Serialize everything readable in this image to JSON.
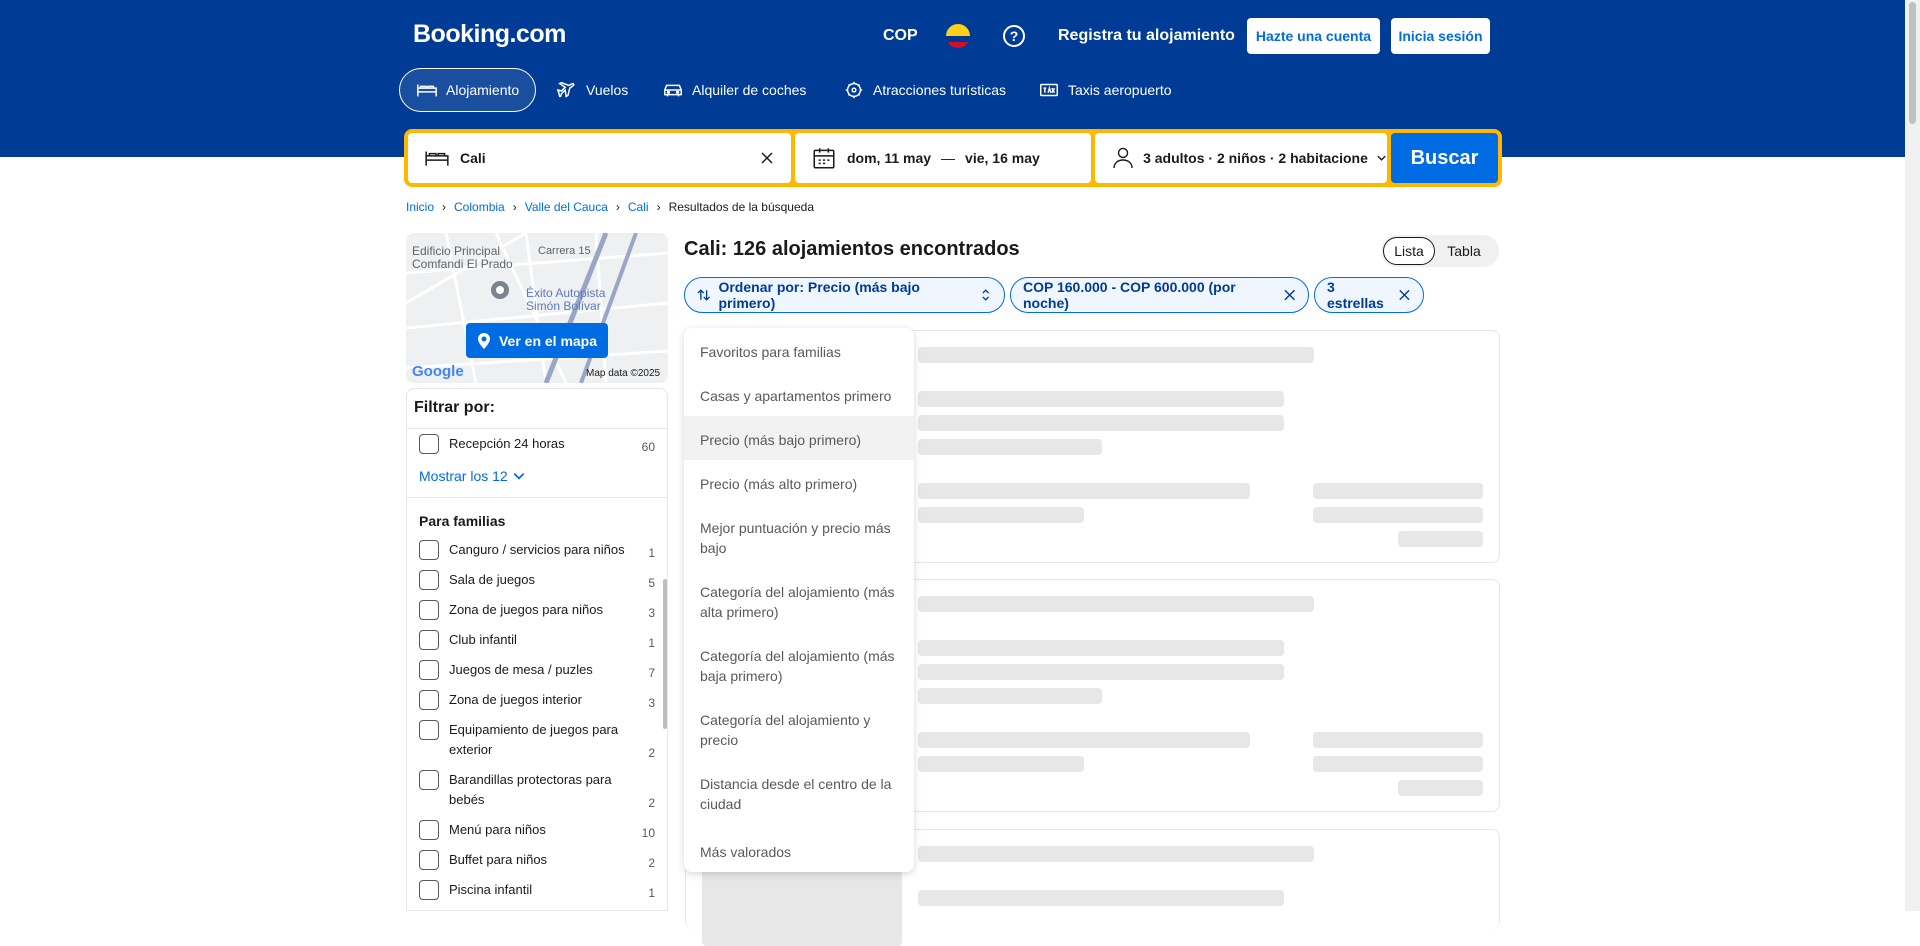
{
  "header": {
    "logo": "Booking.com",
    "currency": "COP",
    "register_property": "Registra tu alojamiento",
    "create_account": "Hazte una cuenta",
    "sign_in": "Inicia sesión",
    "nav": [
      "Alojamiento",
      "Vuelos",
      "Alquiler de coches",
      "Atracciones turísticas",
      "Taxis aeropuerto"
    ]
  },
  "search": {
    "destination": "Cali",
    "checkin": "dom, 11 may",
    "date_sep": "—",
    "checkout": "vie, 16 may",
    "guests": "3 adultos · 2 niños · 2 habitacione",
    "button": "Buscar"
  },
  "breadcrumb": [
    "Inicio",
    "Colombia",
    "Valle del Cauca",
    "Cali",
    "Resultados de la búsqueda"
  ],
  "map": {
    "labels": [
      "Edificio Principal",
      "Comfandi El Prado",
      "Carrera 15",
      "Éxito Autopista",
      "Simón Bolívar"
    ],
    "button": "Ver en el mapa",
    "google": "Google",
    "attribution": "Map data ©2025"
  },
  "filters": {
    "title": "Filtrar por:",
    "top_item": {
      "label": "Recepción 24 horas",
      "count": "60"
    },
    "show_more": "Mostrar los 12",
    "section": "Para familias",
    "items": [
      {
        "label": "Canguro / servicios para niños",
        "count": "1"
      },
      {
        "label": "Sala de juegos",
        "count": "5"
      },
      {
        "label": "Zona de juegos para niños",
        "count": "3"
      },
      {
        "label": "Club infantil",
        "count": "1"
      },
      {
        "label": "Juegos de mesa / puzles",
        "count": "7"
      },
      {
        "label": "Zona de juegos interior",
        "count": "3"
      },
      {
        "label": "Equipamiento de juegos para exterior",
        "count": "2"
      },
      {
        "label": "Barandillas protectoras para bebés",
        "count": "2"
      },
      {
        "label": "Menú para niños",
        "count": "10"
      },
      {
        "label": "Buffet para niños",
        "count": "2"
      },
      {
        "label": "Piscina infantil",
        "count": "1"
      }
    ]
  },
  "results": {
    "title": "Cali: 126 alojamientos encontrados",
    "view_list": "Lista",
    "view_table": "Tabla",
    "sort_chip": "Ordenar por: Precio (más bajo primero)",
    "price_chip": "COP 160.000 - COP 600.000 (por noche)",
    "stars_chip": "3 estrellas"
  },
  "sort_menu": [
    "Favoritos para familias",
    "Casas y apartamentos primero",
    "Precio (más bajo primero)",
    "Precio (más alto primero)",
    "Mejor puntuación y precio más bajo",
    "Categoría del alojamiento (más alta primero)",
    "Categoría del alojamiento (más baja primero)",
    "Categoría del alojamiento y precio",
    "Distancia desde el centro de la ciudad",
    "Más valorados"
  ],
  "sort_selected": "Precio (más bajo primero)",
  "colors": {
    "brand": "#003b95",
    "accent": "#006ce4",
    "search_border": "#ffb700"
  }
}
